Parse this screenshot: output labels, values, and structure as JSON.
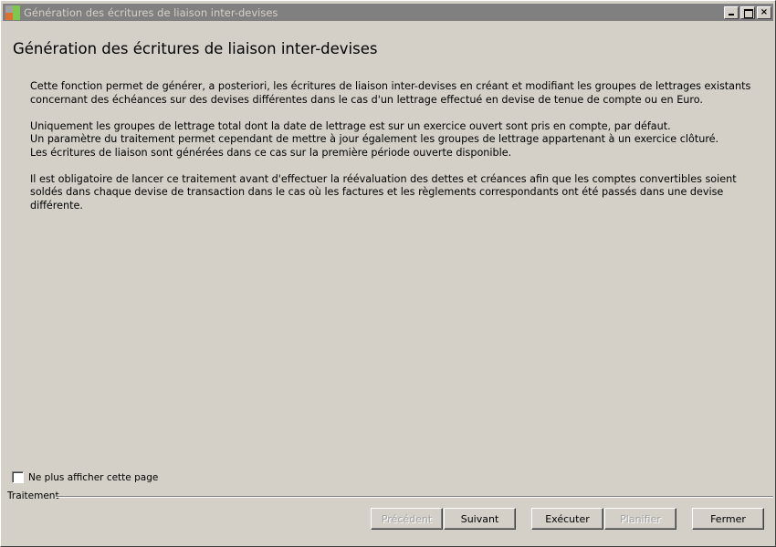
{
  "window": {
    "title": "Génération des écritures de liaison inter-devises",
    "controls": {
      "minimize": "",
      "maximize": "",
      "close": "×"
    }
  },
  "page": {
    "title": "Génération des écritures de liaison inter-devises",
    "paragraphs": [
      [
        "Cette fonction permet de générer, a posteriori, les écritures de liaison inter-devises en créant et modifiant les groupes de lettrages existants",
        "concernant des échéances sur des devises différentes dans le cas d'un lettrage effectué en devise de tenue de compte ou en Euro."
      ],
      [
        "Uniquement les groupes de lettrage total dont la date de lettrage est sur un exercice ouvert sont pris en compte, par défaut.",
        "Un paramètre du traitement permet cependant de mettre à jour également les groupes de lettrage appartenant à un exercice clôturé.",
        "Les écritures de liaison sont générées dans ce cas sur la première période ouverte disponible."
      ],
      [
        "Il est obligatoire de lancer ce traitement avant d'effectuer la réévaluation des dettes et créances afin que les comptes convertibles soient",
        "soldés dans chaque devise de transaction dans le cas où les factures et les règlements correspondants ont été passés dans une devise",
        "différente."
      ]
    ]
  },
  "options": {
    "hide_page_label": "Ne plus afficher cette page",
    "hide_page_checked": false
  },
  "footer": {
    "group_label": "Traitement",
    "buttons": {
      "previous": "Précédent",
      "next": "Suivant",
      "execute": "Exécuter",
      "schedule": "Planifier",
      "close": "Fermer"
    }
  }
}
